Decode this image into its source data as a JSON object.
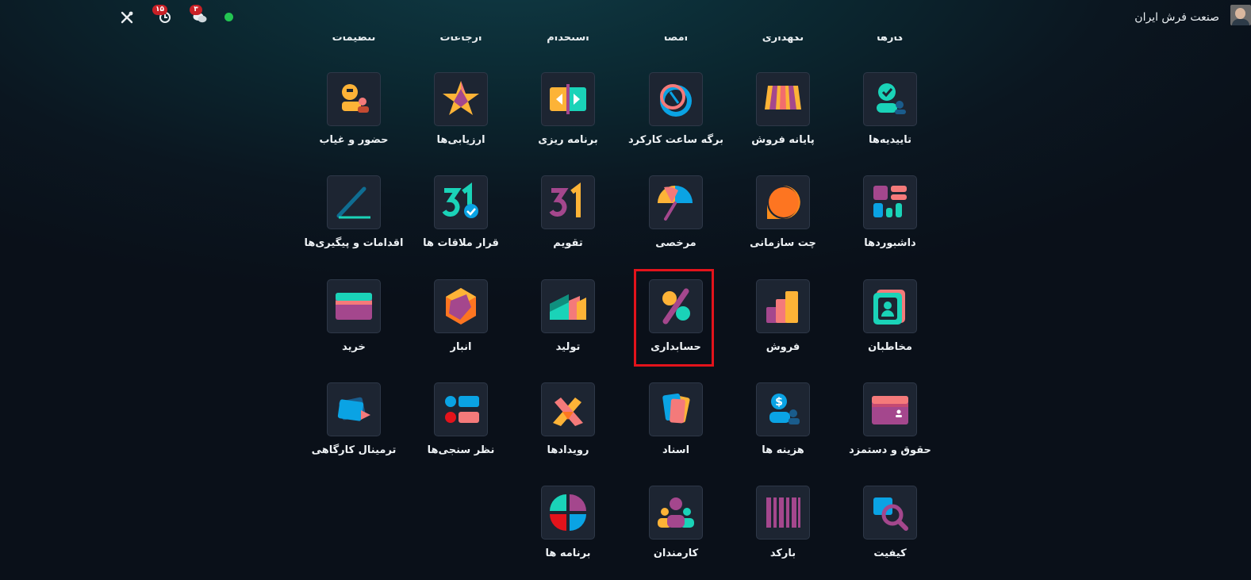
{
  "topbar": {
    "company_name": "صنعت فرش ایران",
    "activity_count": "۱۵",
    "messages_count": "۳",
    "colors": {
      "badge": "#c82026",
      "online": "#23c552"
    }
  },
  "cut_row": [
    "کارها",
    "نگهداری",
    "امضا",
    "استخدام",
    "ارجاعات",
    "تنظیمات"
  ],
  "apps": [
    {
      "label": "تاییدیه‌ها",
      "icon": "approvals-icon"
    },
    {
      "label": "پایانه فروش",
      "icon": "point-of-sale-icon"
    },
    {
      "label": "برگه ساعت کارکرد",
      "icon": "timesheet-icon"
    },
    {
      "label": "برنامه ریزی",
      "icon": "planning-icon"
    },
    {
      "label": "ارزیابی‌ها",
      "icon": "appraisals-icon"
    },
    {
      "label": "حضور و غیاب",
      "icon": "attendance-icon"
    },
    {
      "label": "داشبوردها",
      "icon": "dashboards-icon"
    },
    {
      "label": "چت سازمانی",
      "icon": "discuss-icon"
    },
    {
      "label": "مرخصی",
      "icon": "time-off-icon"
    },
    {
      "label": "تقویم",
      "icon": "calendar-icon"
    },
    {
      "label": "قرار ملاقات ها",
      "icon": "appointments-icon"
    },
    {
      "label": "اقدامات و پیگیری‌ها",
      "icon": "activities-icon"
    },
    {
      "label": "مخاطبان",
      "icon": "contacts-icon"
    },
    {
      "label": "فروش",
      "icon": "sales-icon"
    },
    {
      "label": "حسابداری",
      "icon": "accounting-icon"
    },
    {
      "label": "تولید",
      "icon": "manufacturing-icon"
    },
    {
      "label": "انبار",
      "icon": "inventory-icon"
    },
    {
      "label": "خرید",
      "icon": "purchase-icon"
    },
    {
      "label": "حقوق و دستمزد",
      "icon": "payroll-icon"
    },
    {
      "label": "هزینه ها",
      "icon": "expenses-icon"
    },
    {
      "label": "اسناد",
      "icon": "documents-icon"
    },
    {
      "label": "رویدادها",
      "icon": "events-icon"
    },
    {
      "label": "نظر سنجی‌ها",
      "icon": "surveys-icon"
    },
    {
      "label": "ترمینال کارگاهی",
      "icon": "shop-floor-icon"
    },
    {
      "label": "کیفیت",
      "icon": "quality-icon"
    },
    {
      "label": "بارکد",
      "icon": "barcode-icon"
    },
    {
      "label": "کارمندان",
      "icon": "employees-icon"
    },
    {
      "label": "برنامه ها",
      "icon": "apps-icon"
    }
  ],
  "highlighted_app": "حسابداری",
  "highlight_color": "#e3131b"
}
